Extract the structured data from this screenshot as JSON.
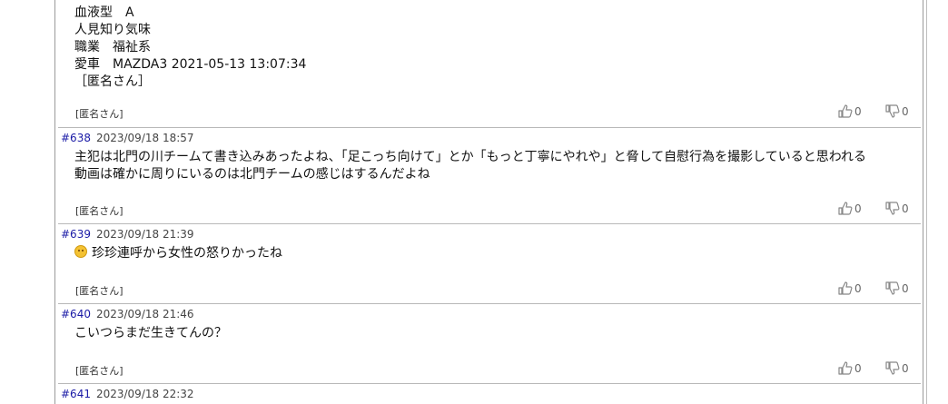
{
  "posts": [
    {
      "lines": [
        "血液型　A",
        "人見知り気味",
        "職業　福祉系",
        "愛車　MAZDA3 2021-05-13 13:07:34",
        "［匿名さん］"
      ],
      "author": "[匿名さん]",
      "likes": "0",
      "dislikes": "0"
    },
    {
      "number": "#638",
      "date": "2023/09/18 18:57",
      "lines": [
        "主犯は北門の川チームて書き込みあったよね、「足こっち向けて」とか「もっと丁寧にやれや」と脅して自慰行為を撮影していると思われる",
        "動画は確かに周りにいるのは北門チームの感じはするんだよね"
      ],
      "author": "[匿名さん]",
      "likes": "0",
      "dislikes": "0"
    },
    {
      "number": "#639",
      "date": "2023/09/18 21:39",
      "emoji_icon": "angry-face-icon",
      "lines": [
        "珍珍連呼から女性の怒りかったね"
      ],
      "author": "[匿名さん]",
      "likes": "0",
      "dislikes": "0"
    },
    {
      "number": "#640",
      "date": "2023/09/18 21:46",
      "lines": [
        "こいつらまだ生きてんの？"
      ],
      "author": "[匿名さん]",
      "likes": "0",
      "dislikes": "0"
    },
    {
      "number": "#641",
      "date": "2023/09/18 22:32"
    }
  ],
  "colors": {
    "post_number": "#1a1aa6",
    "separator": "#b8b8b8",
    "vote_icon": "#888888"
  }
}
